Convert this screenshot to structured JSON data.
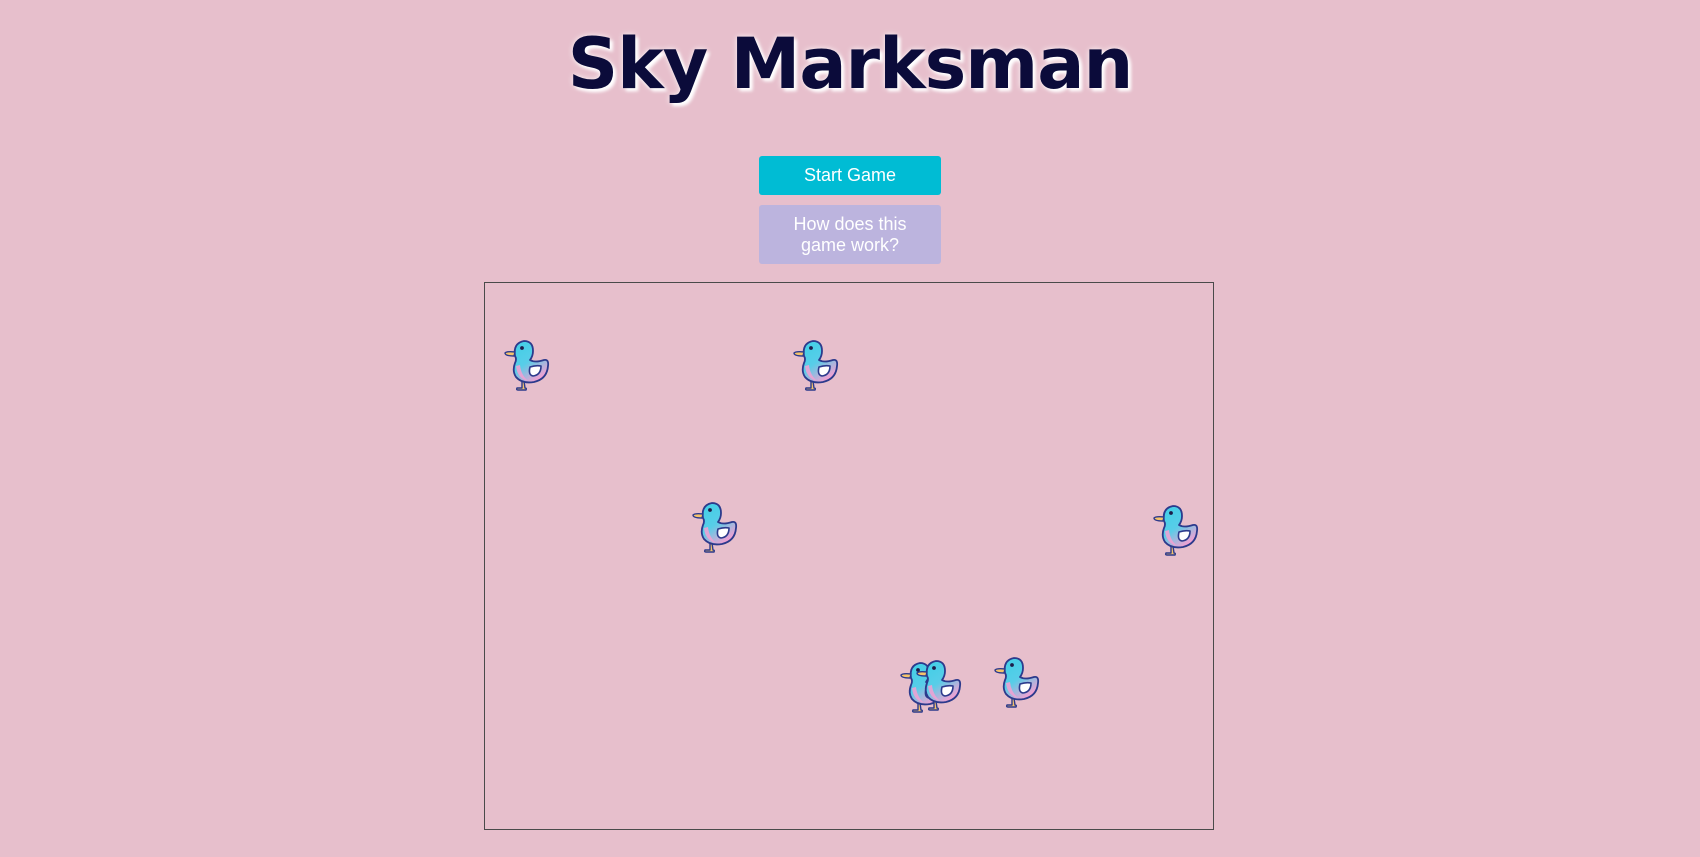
{
  "game": {
    "title": "Sky Marksman",
    "start_button_label": "Start Game",
    "help_button_label": "How does this game work?"
  },
  "arena": {
    "target_icon": "duck-icon",
    "targets": [
      {
        "id": "duck-1"
      },
      {
        "id": "duck-2"
      },
      {
        "id": "duck-3"
      },
      {
        "id": "duck-4"
      },
      {
        "id": "duck-5"
      },
      {
        "id": "duck-6"
      },
      {
        "id": "duck-7"
      }
    ]
  },
  "colors": {
    "background": "#e7bfcc",
    "title": "#0b0b3a",
    "start_button": "#00bcd4",
    "help_button": "#bcb4de",
    "arena_border": "#4a4a4a",
    "duck_body": "#3fd0e6",
    "duck_belly": "#f3a0d2",
    "duck_outline": "#2c3a8c",
    "duck_feet": "#f5c36b"
  }
}
